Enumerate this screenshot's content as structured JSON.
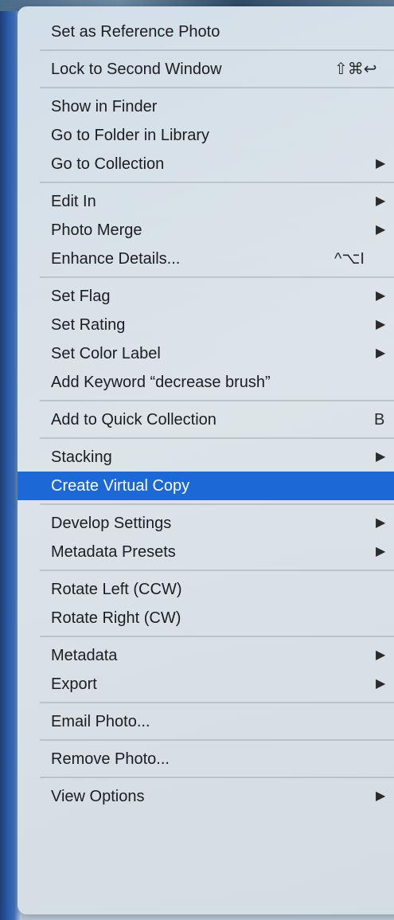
{
  "menu": {
    "groups": [
      [
        {
          "label": "Set as Reference Photo",
          "shortcut": "",
          "submenu": false
        }
      ],
      [
        {
          "label": "Lock to Second Window",
          "shortcut": "⇧⌘↩",
          "submenu": false
        }
      ],
      [
        {
          "label": "Show in Finder",
          "shortcut": "",
          "submenu": false
        },
        {
          "label": "Go to Folder in Library",
          "shortcut": "",
          "submenu": false
        },
        {
          "label": "Go to Collection",
          "shortcut": "",
          "submenu": true
        }
      ],
      [
        {
          "label": "Edit In",
          "shortcut": "",
          "submenu": true
        },
        {
          "label": "Photo Merge",
          "shortcut": "",
          "submenu": true
        },
        {
          "label": "Enhance Details...",
          "shortcut": "^⌥I",
          "submenu": false
        }
      ],
      [
        {
          "label": "Set Flag",
          "shortcut": "",
          "submenu": true
        },
        {
          "label": "Set Rating",
          "shortcut": "",
          "submenu": true
        },
        {
          "label": "Set Color Label",
          "shortcut": "",
          "submenu": true
        },
        {
          "label": "Add Keyword “decrease brush”",
          "shortcut": "",
          "submenu": false
        }
      ],
      [
        {
          "label": "Add to Quick Collection",
          "shortcut": "B",
          "submenu": false
        }
      ],
      [
        {
          "label": "Stacking",
          "shortcut": "",
          "submenu": true
        },
        {
          "label": "Create Virtual Copy",
          "shortcut": "",
          "submenu": false,
          "highlighted": true
        }
      ],
      [
        {
          "label": "Develop Settings",
          "shortcut": "",
          "submenu": true
        },
        {
          "label": "Metadata Presets",
          "shortcut": "",
          "submenu": true
        }
      ],
      [
        {
          "label": "Rotate Left (CCW)",
          "shortcut": "",
          "submenu": false
        },
        {
          "label": "Rotate Right (CW)",
          "shortcut": "",
          "submenu": false
        }
      ],
      [
        {
          "label": "Metadata",
          "shortcut": "",
          "submenu": true
        },
        {
          "label": "Export",
          "shortcut": "",
          "submenu": true
        }
      ],
      [
        {
          "label": "Email Photo...",
          "shortcut": "",
          "submenu": false
        }
      ],
      [
        {
          "label": "Remove Photo...",
          "shortcut": "",
          "submenu": false
        }
      ],
      [
        {
          "label": "View Options",
          "shortcut": "",
          "submenu": true
        }
      ]
    ],
    "submenu_glyph": "▶"
  }
}
